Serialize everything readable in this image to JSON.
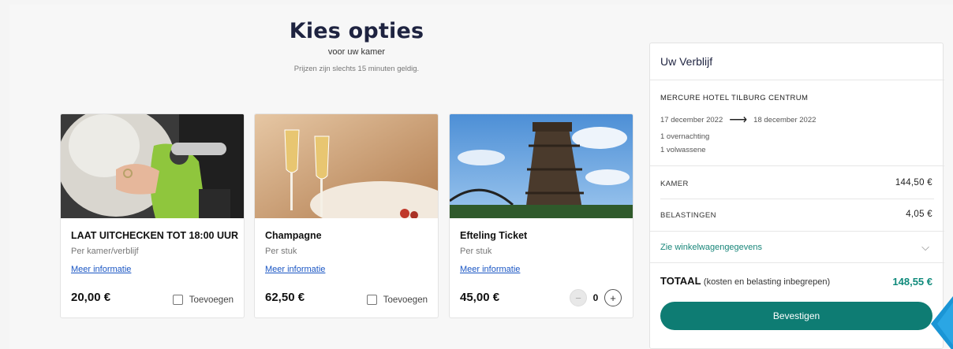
{
  "header": {
    "title": "Kies opties",
    "subtitle": "voor uw kamer",
    "note": "Prijzen zijn slechts 15 minuten geldig."
  },
  "options": [
    {
      "title": "LAAT UITCHECKEN TOT 18:00 UUR",
      "unit": "Per kamer/verblijf",
      "more": "Meer informatie",
      "price": "20,00 €",
      "add_label": "Toevoegen"
    },
    {
      "title": "Champagne",
      "unit": "Per stuk",
      "more": "Meer informatie",
      "price": "62,50 €",
      "add_label": "Toevoegen"
    },
    {
      "title": "Efteling Ticket",
      "unit": "Per stuk",
      "more": "Meer informatie",
      "price": "45,00 €",
      "quantity": "0",
      "minus": "−",
      "plus": "+"
    }
  ],
  "summary": {
    "title": "Uw Verblijf",
    "hotel": "MERCURE HOTEL TILBURG CENTRUM",
    "checkin": "17 december 2022",
    "arrow": "⟶",
    "checkout": "18 december 2022",
    "nights": "1 overnachting",
    "guests": "1 volwassene",
    "room_label": "KAMER",
    "room_value": "144,50 €",
    "tax_label": "BELASTINGEN",
    "tax_value": "4,05 €",
    "cart_link": "Zie winkelwagengegevens",
    "chevron": "⌵",
    "total_label": "TOTAAL",
    "total_note": "(kosten en belasting inbegrepen)",
    "total_value": "148,55 €",
    "confirm_label": "Bevestigen"
  },
  "colors": {
    "accent": "#0e7c73",
    "total": "#0f8a7b",
    "link": "#1a56c4",
    "heading": "#1e2340"
  }
}
